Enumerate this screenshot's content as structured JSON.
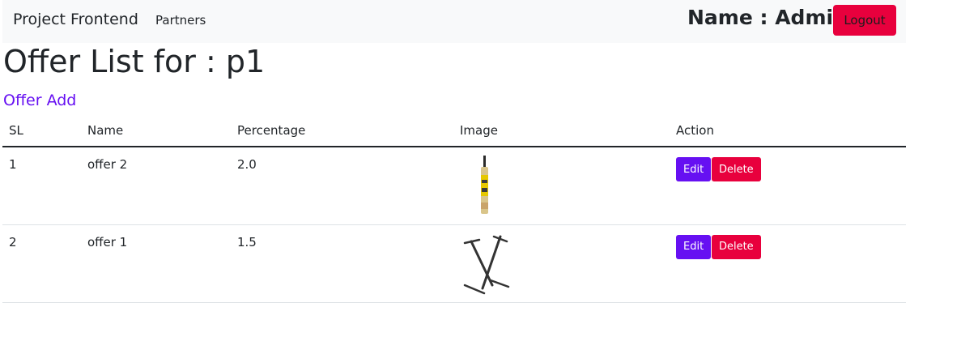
{
  "navbar": {
    "brand": "Project Frontend",
    "links": [
      "Partners"
    ],
    "user_label": "Name : Admin",
    "logout_label": "Logout"
  },
  "page": {
    "title": "Offer List for : p1",
    "add_link": "Offer Add"
  },
  "table": {
    "headers": [
      "SL",
      "Name",
      "Percentage",
      "Image",
      "Action"
    ],
    "rows": [
      {
        "sl": "1",
        "name": "offer 2",
        "percentage": "2.0",
        "image": "cricket-bat-image",
        "edit": "Edit",
        "delete": "Delete"
      },
      {
        "sl": "2",
        "name": "offer 1",
        "percentage": "1.5",
        "image": "x-stand-image",
        "edit": "Edit",
        "delete": "Delete"
      }
    ]
  },
  "colors": {
    "primary": "#6610f2",
    "danger": "#e8003d",
    "navbar_bg": "#f8f9fa",
    "text": "#212529"
  }
}
